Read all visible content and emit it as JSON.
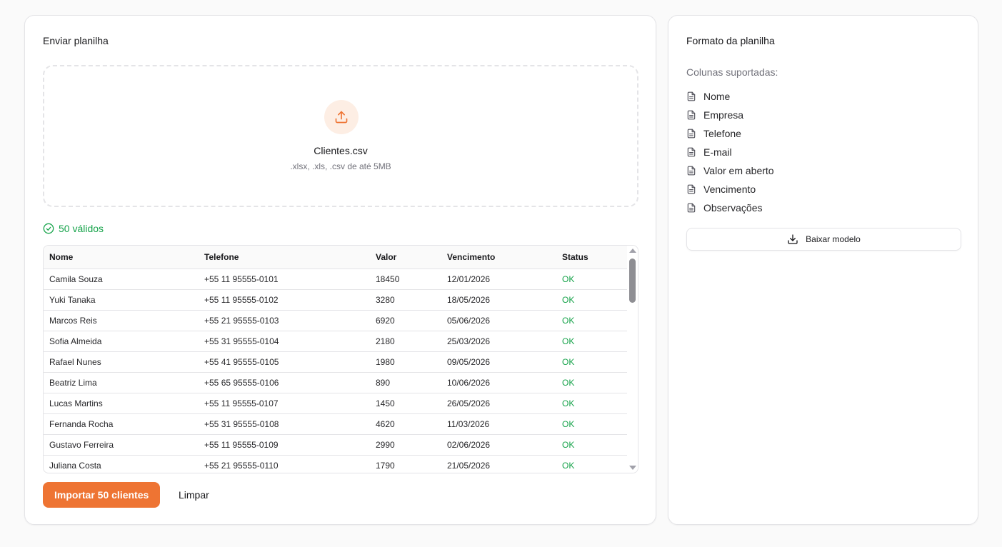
{
  "upload_card": {
    "title": "Enviar planilha",
    "file_name": "Clientes.csv",
    "file_hint": ".xlsx, .xls, .csv de até 5MB",
    "valid_count_label": "50 válidos",
    "accent_color": "#ee7433",
    "success_color": "#16a34a"
  },
  "table": {
    "columns": [
      "Nome",
      "Telefone",
      "Valor",
      "Vencimento",
      "Status"
    ],
    "rows": [
      [
        "Camila Souza",
        "+55 11 95555-0101",
        "18450",
        "12/01/2026",
        "OK"
      ],
      [
        "Yuki Tanaka",
        "+55 11 95555-0102",
        "3280",
        "18/05/2026",
        "OK"
      ],
      [
        "Marcos Reis",
        "+55 21 95555-0103",
        "6920",
        "05/06/2026",
        "OK"
      ],
      [
        "Sofia Almeida",
        "+55 31 95555-0104",
        "2180",
        "25/03/2026",
        "OK"
      ],
      [
        "Rafael Nunes",
        "+55 41 95555-0105",
        "1980",
        "09/05/2026",
        "OK"
      ],
      [
        "Beatriz Lima",
        "+55 65 95555-0106",
        "890",
        "10/06/2026",
        "OK"
      ],
      [
        "Lucas Martins",
        "+55 11 95555-0107",
        "1450",
        "26/05/2026",
        "OK"
      ],
      [
        "Fernanda Rocha",
        "+55 31 95555-0108",
        "4620",
        "11/03/2026",
        "OK"
      ],
      [
        "Gustavo Ferreira",
        "+55 11 95555-0109",
        "2990",
        "02/06/2026",
        "OK"
      ],
      [
        "Juliana Costa",
        "+55 21 95555-0110",
        "1790",
        "21/05/2026",
        "OK"
      ]
    ]
  },
  "actions": {
    "import_label": "Importar 50 clientes",
    "clear_label": "Limpar"
  },
  "format_card": {
    "title": "Formato da planilha",
    "columns_label": "Colunas suportadas:",
    "supported_columns": [
      "Nome",
      "Empresa",
      "Telefone",
      "E-mail",
      "Valor em aberto",
      "Vencimento",
      "Observações"
    ],
    "download_label": "Baixar modelo"
  },
  "icons": {
    "upload": "upload-icon",
    "check": "check-circle-icon",
    "file": "file-text-icon",
    "download": "download-icon"
  }
}
